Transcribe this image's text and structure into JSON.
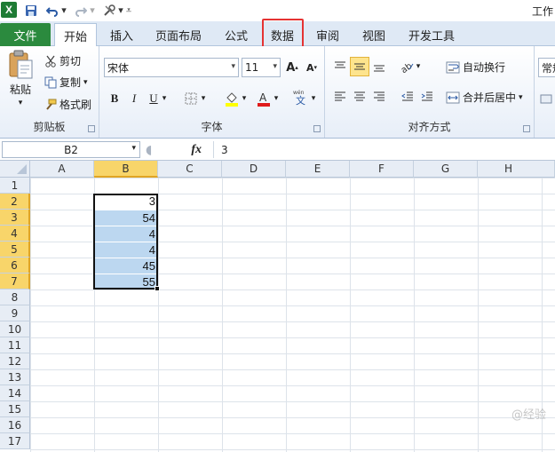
{
  "qat": {
    "title_partial": "工作"
  },
  "tabs": {
    "file": "文件",
    "items": [
      {
        "label": "开始"
      },
      {
        "label": "插入"
      },
      {
        "label": "页面布局"
      },
      {
        "label": "公式"
      },
      {
        "label": "数据"
      },
      {
        "label": "审阅"
      },
      {
        "label": "视图"
      },
      {
        "label": "开发工具"
      }
    ]
  },
  "ribbon": {
    "clipboard": {
      "label": "剪贴板",
      "paste": "粘贴",
      "cut": "剪切",
      "copy": "复制",
      "format_painter": "格式刷"
    },
    "font": {
      "label": "字体",
      "font_name": "宋体",
      "font_size": "11",
      "bold": "B",
      "italic": "I",
      "underline": "U"
    },
    "alignment": {
      "label": "对齐方式",
      "wrap_text": "自动换行",
      "merge_center": "合并后居中"
    },
    "number": {
      "format_partial": "常规"
    }
  },
  "formula_bar": {
    "name_box": "B2",
    "fx": "fx",
    "value": "3"
  },
  "grid": {
    "columns": [
      "A",
      "B",
      "C",
      "D",
      "E",
      "F",
      "G",
      "H"
    ],
    "rows": [
      "1",
      "2",
      "3",
      "4",
      "5",
      "6",
      "7",
      "8",
      "9",
      "10",
      "11",
      "12",
      "13",
      "14",
      "15",
      "16",
      "17"
    ],
    "selected_column": "B",
    "selected_rows": [
      "2",
      "3",
      "4",
      "5",
      "6",
      "7"
    ],
    "b_values": [
      "3",
      "54",
      "4",
      "4",
      "45",
      "55"
    ]
  },
  "watermark": "@经验"
}
